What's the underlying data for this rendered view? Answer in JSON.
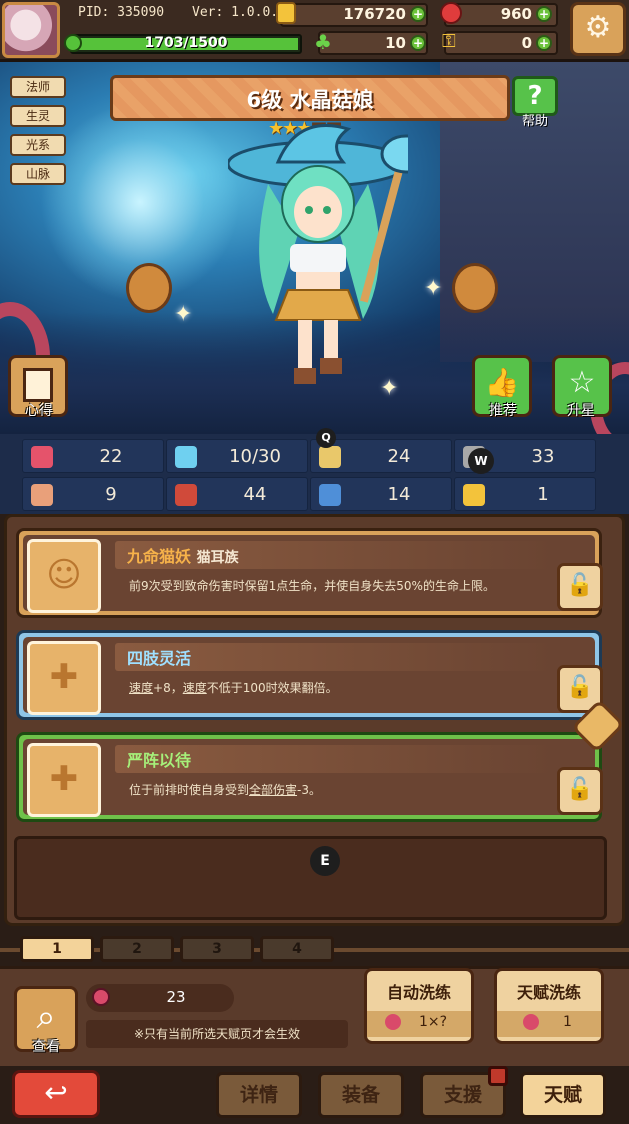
{
  "top": {
    "pid": "PID: 335090",
    "version": "Ver: 1.0.0.1",
    "gold": "176720",
    "gems": "960",
    "exp": "1703/1500",
    "clover": "10",
    "keys": "0"
  },
  "hero": {
    "tags": [
      "法师",
      "生灵",
      "光系",
      "山脉"
    ],
    "title": "6级  水晶菇娘",
    "stars_filled": 3,
    "stars_total": 5,
    "help_label": "帮助",
    "left_button": "心得",
    "recommend_button": "推荐",
    "upgrade_button": "升星"
  },
  "stats": [
    {
      "icon": "heart-icon",
      "value": "22",
      "color": "#e5536b"
    },
    {
      "icon": "water-drop-icon",
      "value": "10/30",
      "color": "#6fd0f0"
    },
    {
      "icon": "cup-icon",
      "value": "24",
      "color": "#e9c86a"
    },
    {
      "icon": "stone-icon",
      "value": "33",
      "color": "#a8a8a8"
    },
    {
      "icon": "fist-icon",
      "value": "9",
      "color": "#e9a07a"
    },
    {
      "icon": "book-icon",
      "value": "44",
      "color": "#d04a3a"
    },
    {
      "icon": "scroll-icon",
      "value": "14",
      "color": "#4f8fd8"
    },
    {
      "icon": "horseshoe-icon",
      "value": "1",
      "color": "#f3c33b"
    }
  ],
  "talents": [
    {
      "name": "九命猫妖",
      "tag": "猫耳族",
      "desc": "前9次受到致命伤害时保留1点生命，并使自身失去50%的生命上限。",
      "name_color": "#f6b24a",
      "border": "#d9a25a"
    },
    {
      "name": "四肢灵活",
      "tag": "",
      "desc_parts": [
        "速度",
        "+8，",
        "速度",
        "不低于100时效果翻倍。"
      ],
      "name_color": "#9fe0ff",
      "border": "#8fc6e8"
    },
    {
      "name": "严阵以待",
      "tag": "",
      "desc_parts": [
        "位于前排时使自身受到",
        "全部伤害",
        "-3。"
      ],
      "name_color": "#a6f07a",
      "border": "#6fc24a"
    }
  ],
  "markers": {
    "q": "Q",
    "w": "W",
    "e": "E"
  },
  "pages": [
    "1",
    "2",
    "3",
    "4"
  ],
  "bottom": {
    "search_label": "查看",
    "tonic_count": "23",
    "notice": "※只有当前所选天赋页才会生效",
    "auto_wash": {
      "title": "自动洗练",
      "cost": "1×?"
    },
    "talent_wash": {
      "title": "天赋洗练",
      "cost": "1"
    }
  },
  "nav": [
    "详情",
    "装备",
    "支援",
    "天赋"
  ]
}
